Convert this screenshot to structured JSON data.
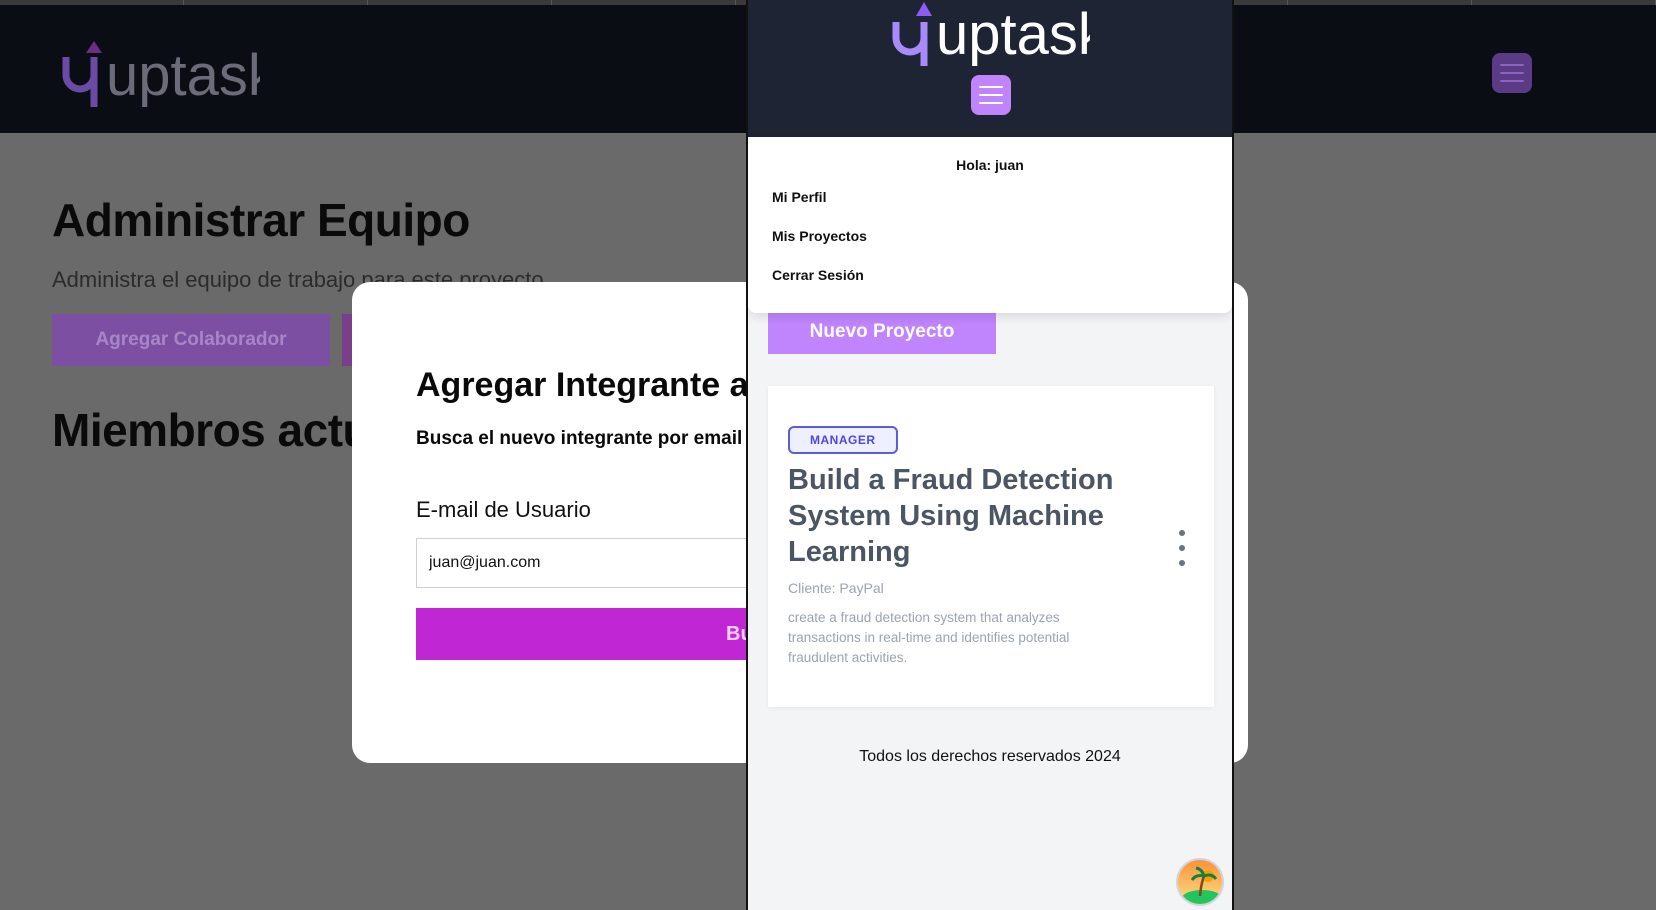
{
  "app": {
    "logo_text": "uptask",
    "colors": {
      "header_bg": "#0b0d14",
      "accent": "#c084fc",
      "primary_button": "#c026d3",
      "badge": "#4f46e5"
    }
  },
  "page": {
    "title": "Administrar Equipo",
    "subtitle": "Administra el equipo de trabajo para este proyecto",
    "add_collaborator_label": "Agregar Colaborador",
    "members_heading": "Miembros actuales"
  },
  "modal": {
    "title": "Agregar Integrante al equipo",
    "subtitle": "Busca el nuevo integrante por email",
    "email_label": "E-mail de Usuario",
    "email_value": "juan@juan.com",
    "search_button": "Buscar Usuario"
  },
  "mobile": {
    "greeting": "Hola: juan",
    "menu_items": [
      "Mi Perfil",
      "Mis Proyectos",
      "Cerrar Sesión"
    ],
    "new_project_label": "Nuevo Proyecto",
    "project": {
      "role_badge": "MANAGER",
      "name": "Build a Fraud Detection System Using Machine Learning",
      "client": "Cliente: PayPal",
      "description": "create a fraud detection system that analyzes transactions in real-time and identifies potential fraudulent activities."
    },
    "footer": "Todos los derechos reservados 2024",
    "icons": {
      "menu": "hamburger-icon",
      "options": "kebab-menu-icon",
      "avatar": "user-avatar-icon"
    }
  }
}
